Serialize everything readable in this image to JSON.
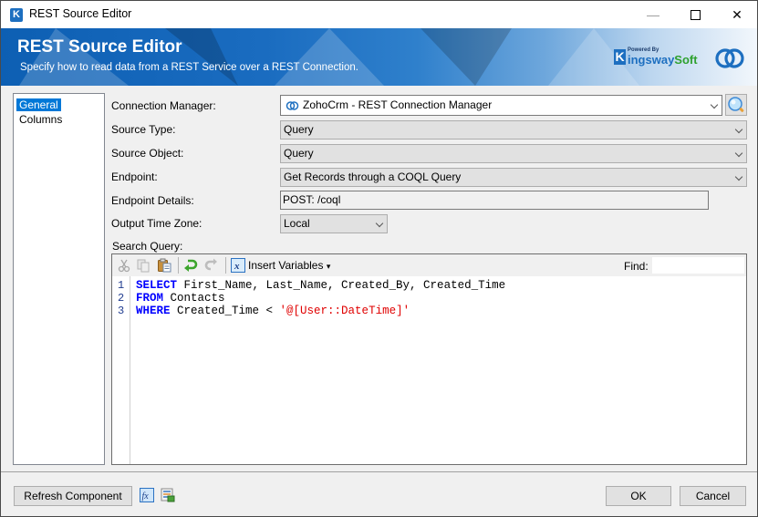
{
  "window": {
    "title": "REST Source Editor",
    "app_icon_letter": "K",
    "controls": {
      "minimize": "—",
      "close": "✕"
    }
  },
  "banner": {
    "title": "REST Source Editor",
    "subtitle": "Specify how to read data from a REST Service over a REST Connection.",
    "logo_powered_by": "Powered By",
    "logo_k": "K",
    "logo_name_a": "ingsway",
    "logo_name_b": "Soft",
    "brand_color": "#1d6fc0",
    "brand_green": "#2ea12e"
  },
  "nav": {
    "items": [
      {
        "label": "General",
        "selected": true
      },
      {
        "label": "Columns",
        "selected": false
      }
    ]
  },
  "form": {
    "connection_manager": {
      "label": "Connection Manager:",
      "value": "ZohoCrm - REST Connection Manager",
      "icon": "zoho-link-icon"
    },
    "source_type": {
      "label": "Source Type:",
      "value": "Query"
    },
    "source_object": {
      "label": "Source Object:",
      "value": "Query"
    },
    "endpoint": {
      "label": "Endpoint:",
      "value": "Get Records through a COQL Query"
    },
    "endpoint_details": {
      "label": "Endpoint Details:",
      "value": "POST: /coql"
    },
    "output_time_zone": {
      "label": "Output Time Zone:",
      "value": "Local"
    },
    "search_query_label": "Search Query:"
  },
  "editor": {
    "toolbar": {
      "cut": "cut-icon",
      "copy": "copy-icon",
      "paste": "paste-icon",
      "undo": "undo-icon",
      "redo": "redo-icon",
      "insert_variables_label": "Insert Variables",
      "insert_variables_caret": "▾",
      "find_label": "Find:",
      "find_value": ""
    },
    "lines": [
      {
        "num": "1",
        "kw": "SELECT",
        "rest": " First_Name, Last_Name, Created_By, Created_Time",
        "str": ""
      },
      {
        "num": "2",
        "kw": "FROM",
        "rest": " Contacts",
        "str": ""
      },
      {
        "num": "3",
        "kw": "WHERE",
        "rest": " Created_Time < ",
        "str": "'@[User::DateTime]'"
      }
    ]
  },
  "footer": {
    "refresh_label": "Refresh Component",
    "fx_label": "fx",
    "ok_label": "OK",
    "cancel_label": "Cancel"
  }
}
